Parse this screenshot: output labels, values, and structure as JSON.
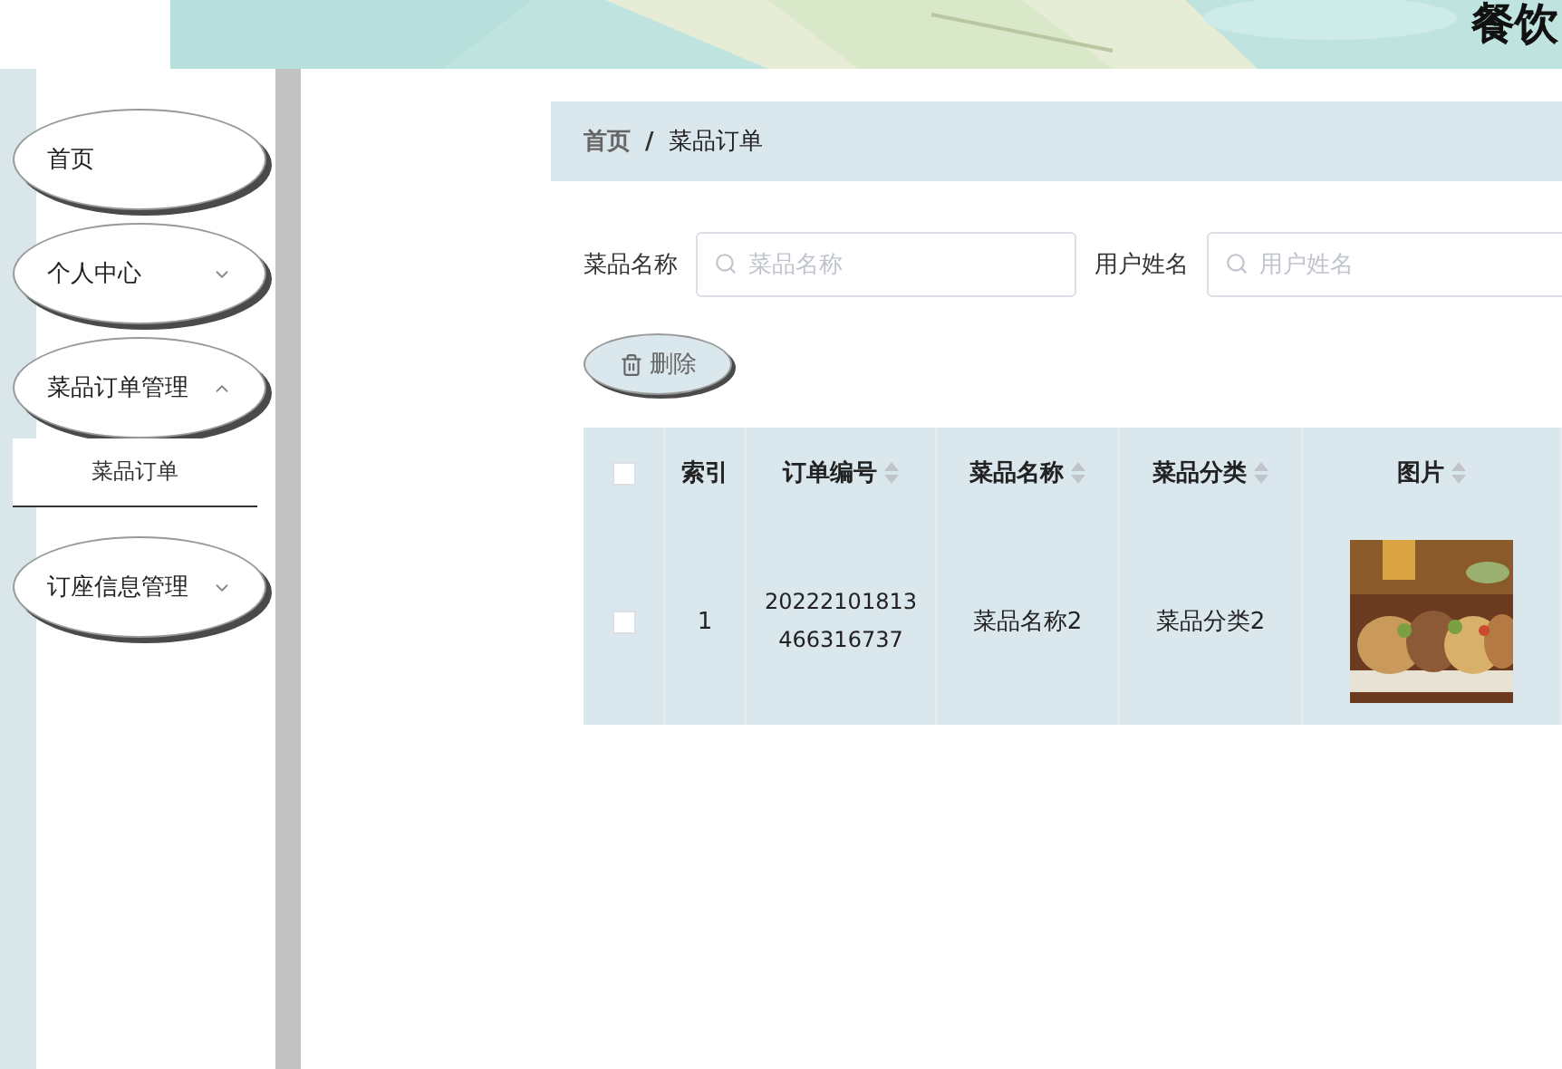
{
  "header": {
    "title": "餐饮"
  },
  "sidebar": {
    "items": [
      {
        "label": "首页",
        "kind": "link"
      },
      {
        "label": "个人中心",
        "kind": "submenu",
        "expanded": false
      },
      {
        "label": "菜品订单管理",
        "kind": "submenu",
        "expanded": true,
        "children": [
          {
            "label": "菜品订单"
          }
        ]
      },
      {
        "label": "订座信息管理",
        "kind": "submenu",
        "expanded": false
      }
    ]
  },
  "breadcrumb": [
    "首页",
    "菜品订单"
  ],
  "breadcrumb_separator": "/",
  "filters": [
    {
      "label": "菜品名称",
      "placeholder": "菜品名称"
    },
    {
      "label": "用户姓名",
      "placeholder": "用户姓名"
    }
  ],
  "actions": [
    {
      "label": "删除"
    }
  ],
  "table": {
    "select_all": {
      "checked": false
    },
    "columns": [
      {
        "label": "索引",
        "sortable": false
      },
      {
        "label": "订单编号",
        "sortable": true
      },
      {
        "label": "菜品名称",
        "sortable": true
      },
      {
        "label": "菜品分类",
        "sortable": true
      },
      {
        "label": "图片",
        "sortable": true
      }
    ],
    "rows": [
      {
        "checked": false,
        "cells": [
          "1",
          "20222101813466316737",
          "菜品名称2",
          "菜品分类2"
        ],
        "image": {
          "kind": "picture"
        }
      }
    ]
  }
}
